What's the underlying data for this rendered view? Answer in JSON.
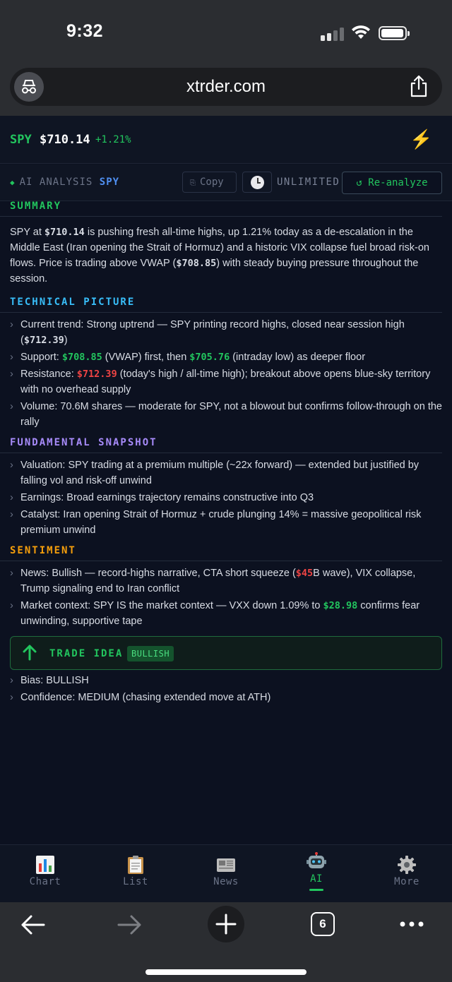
{
  "status": {
    "time": "9:32"
  },
  "browser": {
    "url": "xtrder.com",
    "tab_count": "6"
  },
  "ticker": {
    "symbol": "SPY",
    "price": "$710.14",
    "change": "+1.21%"
  },
  "ai_bar": {
    "title": "AI ANALYSIS",
    "symbol": "SPY",
    "copy_label": "Copy",
    "plan_label": "UNLIMITED",
    "reanalyze_label": "↺ Re-analyze"
  },
  "summary": {
    "heading": "SUMMARY",
    "p1": "SPY at ",
    "v1": "$710.14",
    "p2": " is pushing fresh all-time highs, up 1.21% today as a de-escalation in the Middle East (Iran opening the Strait of Hormuz) and a historic VIX collapse fuel broad risk-on flows. Price is trading above VWAP (",
    "v2": "$708.85",
    "p3": ") with steady buying pressure throughout the session."
  },
  "technical": {
    "heading": "TECHNICAL PICTURE",
    "trend_a": "Current trend: Strong uptrend — SPY printing record highs, closed near session high (",
    "trend_v": "$712.39",
    "trend_b": ")",
    "support_a": "Support: ",
    "support_v1": "$708.85",
    "support_b": " (VWAP) first, then ",
    "support_v2": "$705.76",
    "support_c": " (intraday low) as deeper floor",
    "resist_a": "Resistance: ",
    "resist_v": "$712.39",
    "resist_b": " (today's high / all-time high); breakout above opens blue-sky territory with no overhead supply",
    "volume": "Volume: 70.6M shares — moderate for SPY, not a blowout but confirms follow-through on the rally"
  },
  "fundamental": {
    "heading": "FUNDAMENTAL SNAPSHOT",
    "valuation": "Valuation: SPY trading at a premium multiple (~22x forward) — extended but justified by falling vol and risk-off unwind",
    "earnings": "Earnings: Broad earnings trajectory remains constructive into Q3",
    "catalyst": "Catalyst: Iran opening Strait of Hormuz + crude plunging 14% = massive geopolitical risk premium unwind"
  },
  "sentiment": {
    "heading": "SENTIMENT",
    "news_a": "News: Bullish — record-highs narrative, CTA short squeeze (",
    "news_v": "$45",
    "news_b": "B wave), VIX collapse, Trump signaling end to Iran conflict",
    "market_a": "Market context: SPY IS the market context — VXX down 1.09% to ",
    "market_v": "$28.98",
    "market_b": " confirms fear unwinding, supportive tape"
  },
  "trade": {
    "heading": "TRADE IDEA",
    "badge": "BULLISH",
    "bias": "Bias: BULLISH",
    "confidence": "Confidence: MEDIUM (chasing extended move at ATH)"
  },
  "tabs": [
    {
      "label": "Chart",
      "icon": "bar-chart-icon"
    },
    {
      "label": "List",
      "icon": "clipboard-icon"
    },
    {
      "label": "News",
      "icon": "newspaper-icon"
    },
    {
      "label": "AI",
      "icon": "robot-icon"
    },
    {
      "label": "More",
      "icon": "gear-icon"
    }
  ],
  "colors": {
    "accent": "#22c55e",
    "negative": "#ef4444",
    "bolt": "#f5b70f",
    "background": "#0c1120"
  }
}
